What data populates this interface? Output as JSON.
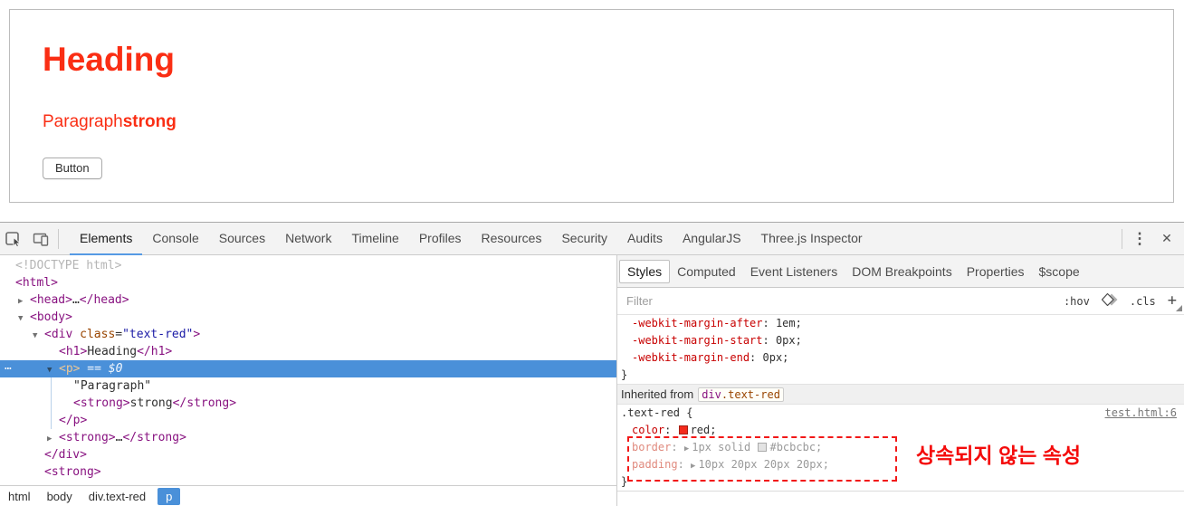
{
  "colors": {
    "page_red": "#fa2e14",
    "annotation_red": "#f40b0b",
    "selection_blue": "#4a90d9",
    "tab_underline_blue": "#569ae4",
    "preview_border": "#bcbcbc"
  },
  "page_preview": {
    "heading": "Heading",
    "paragraph": "Paragraph",
    "paragraph_strong": "strong",
    "button": "Button"
  },
  "devtools_toolbar": {
    "tabs": [
      "Elements",
      "Console",
      "Sources",
      "Network",
      "Timeline",
      "Profiles",
      "Resources",
      "Security",
      "Audits",
      "AngularJS",
      "Three.js Inspector"
    ],
    "active_tab": "Elements",
    "menu_icon": "⋮",
    "close_icon": "✕"
  },
  "elements_panel": {
    "tree": [
      {
        "indent": 0,
        "tokens": [
          {
            "c": "doctype",
            "t": "<!DOCTYPE html>"
          }
        ]
      },
      {
        "indent": 0,
        "tokens": [
          {
            "c": "tag",
            "t": "<html>"
          }
        ]
      },
      {
        "indent": 1,
        "arrow": "right",
        "tokens": [
          {
            "c": "tag",
            "t": "<head>"
          },
          {
            "c": "text",
            "t": "…"
          },
          {
            "c": "tag",
            "t": "</head>"
          }
        ]
      },
      {
        "indent": 1,
        "arrow": "down",
        "tokens": [
          {
            "c": "tag",
            "t": "<body>"
          }
        ]
      },
      {
        "indent": 2,
        "arrow": "down",
        "tokens": [
          {
            "c": "tag",
            "t": "<div"
          },
          {
            "c": "text",
            "t": " "
          },
          {
            "c": "attr",
            "t": "class"
          },
          {
            "c": "text",
            "t": "="
          },
          {
            "c": "attrval",
            "t": "\"text-red\""
          },
          {
            "c": "tag",
            "t": ">"
          }
        ]
      },
      {
        "indent": 3,
        "tokens": [
          {
            "c": "tag",
            "t": "<h1>"
          },
          {
            "c": "text",
            "t": "Heading"
          },
          {
            "c": "tag",
            "t": "</h1>"
          }
        ]
      },
      {
        "indent": 3,
        "arrow": "down",
        "selected": true,
        "dots": true,
        "tokens": [
          {
            "c": "tag",
            "t": "<p>"
          },
          {
            "c": "meta",
            "t": " == $0"
          }
        ]
      },
      {
        "indent": 4,
        "tokens": [
          {
            "c": "text",
            "t": "\"Paragraph\""
          }
        ]
      },
      {
        "indent": 4,
        "tokens": [
          {
            "c": "tag",
            "t": "<strong>"
          },
          {
            "c": "text",
            "t": "strong"
          },
          {
            "c": "tag",
            "t": "</strong>"
          }
        ]
      },
      {
        "indent": 3,
        "tokens": [
          {
            "c": "tag",
            "t": "</p>"
          }
        ]
      },
      {
        "indent": 3,
        "arrow": "right",
        "tokens": [
          {
            "c": "tag",
            "t": "<strong>"
          },
          {
            "c": "text",
            "t": "…"
          },
          {
            "c": "tag",
            "t": "</strong>"
          }
        ]
      },
      {
        "indent": 2,
        "tokens": [
          {
            "c": "tag",
            "t": "</div>"
          }
        ]
      },
      {
        "indent": 2,
        "tokens": [
          {
            "c": "tag",
            "t": "<strong>"
          }
        ]
      }
    ],
    "breadcrumbs": [
      {
        "label": "html",
        "selected": false
      },
      {
        "label": "body",
        "selected": false
      },
      {
        "label": "div.text-red",
        "selected": false
      },
      {
        "label": "p",
        "selected": true
      }
    ]
  },
  "styles_panel": {
    "tabs": [
      "Styles",
      "Computed",
      "Event Listeners",
      "DOM Breakpoints",
      "Properties",
      "$scope"
    ],
    "active_tab": "Styles",
    "filter_placeholder": "Filter",
    "controls": {
      "hover": ":hov",
      "class": ".cls",
      "add": "+"
    },
    "rows": [
      {
        "type": "code",
        "pad": true,
        "tokens": [
          {
            "c": "prop",
            "t": "-webkit-margin-after"
          },
          {
            "c": "plain",
            "t": ": "
          },
          {
            "c": "val",
            "t": "1em;"
          }
        ]
      },
      {
        "type": "code",
        "pad": true,
        "tokens": [
          {
            "c": "prop",
            "t": "-webkit-margin-start"
          },
          {
            "c": "plain",
            "t": ": "
          },
          {
            "c": "val",
            "t": "0px;"
          }
        ]
      },
      {
        "type": "code",
        "pad": true,
        "tokens": [
          {
            "c": "prop",
            "t": "-webkit-margin-end"
          },
          {
            "c": "plain",
            "t": ": "
          },
          {
            "c": "val",
            "t": "0px;"
          }
        ]
      },
      {
        "type": "code",
        "tokens": [
          {
            "c": "plain",
            "t": "}"
          }
        ]
      },
      {
        "type": "section",
        "label": "Inherited from",
        "chip": [
          {
            "c": "chip-tag",
            "t": "div"
          },
          {
            "c": "chip-cls",
            "t": ".text-red"
          }
        ]
      },
      {
        "type": "code",
        "link": "test.html:6",
        "tokens": [
          {
            "c": "plain",
            "t": ".text-red {"
          }
        ]
      },
      {
        "type": "code",
        "pad": true,
        "tokens": [
          {
            "c": "prop",
            "t": "color"
          },
          {
            "c": "plain",
            "t": ": "
          },
          {
            "c": "swred"
          },
          {
            "c": "val",
            "t": "red;"
          }
        ]
      },
      {
        "type": "code",
        "pad": true,
        "tokens": [
          {
            "c": "gprop",
            "t": "border"
          },
          {
            "c": "gplain",
            "t": ": "
          },
          {
            "c": "tri",
            "t": "▶"
          },
          {
            "c": "gval",
            "t": "1px solid "
          },
          {
            "c": "swgray"
          },
          {
            "c": "gval",
            "t": "#bcbcbc;"
          }
        ]
      },
      {
        "type": "code",
        "pad": true,
        "tokens": [
          {
            "c": "gprop",
            "t": "padding"
          },
          {
            "c": "gplain",
            "t": ": "
          },
          {
            "c": "tri",
            "t": "▶"
          },
          {
            "c": "gval",
            "t": "10px 20px 20px 20px;"
          }
        ]
      },
      {
        "type": "code",
        "tokens": [
          {
            "c": "plain",
            "t": "}"
          }
        ]
      },
      {
        "type": "divider"
      }
    ],
    "annotation": "상속되지 않는 속성"
  }
}
